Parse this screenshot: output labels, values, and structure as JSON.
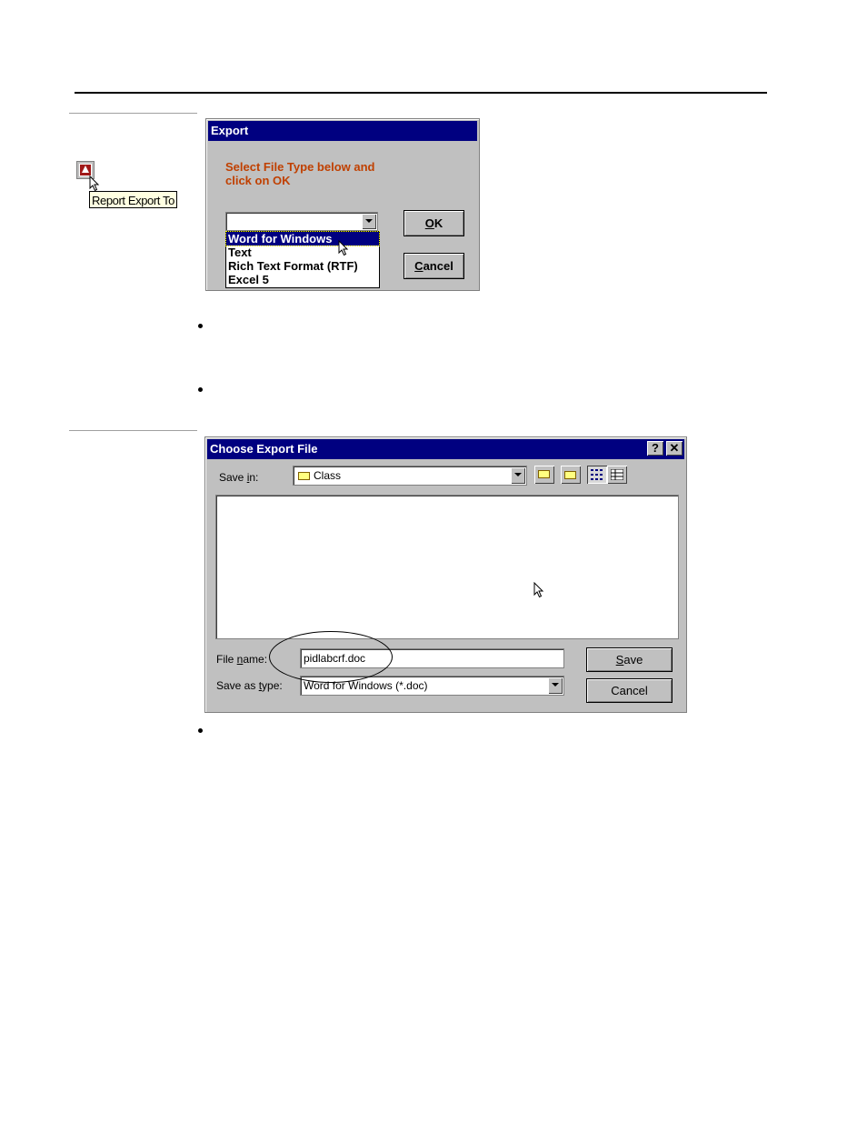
{
  "tooltip": {
    "text": "Report Export To"
  },
  "export_dialog": {
    "title": "Export",
    "prompt_line1": "Select File Type below and",
    "prompt_line2": "click on OK",
    "select_value": "",
    "options": [
      "Word for Windows",
      "Text",
      "Rich Text Format (RTF)",
      "Excel 5"
    ],
    "selected_index": 0,
    "ok_label": "OK",
    "ok_mnemonic": "O",
    "ok_rest": "K",
    "cancel_mnemonic": "C",
    "cancel_rest": "ancel"
  },
  "save_dialog": {
    "title": "Choose Export File",
    "help_glyph": "?",
    "close_glyph": "✕",
    "save_in_label_pre": "Save ",
    "save_in_label_mn": "i",
    "save_in_label_post": "n:",
    "save_in_value": "Class",
    "file_name_label_pre": "File ",
    "file_name_label_mn": "n",
    "file_name_label_post": "ame:",
    "file_name_value": "pidlabcrf.doc",
    "save_as_type_label_pre": "Save as ",
    "save_as_type_label_mn": "t",
    "save_as_type_label_post": "ype:",
    "save_as_type_value": "Word for Windows (*.doc)",
    "save_mn": "S",
    "save_rest": "ave",
    "cancel_label": "Cancel"
  },
  "colors": {
    "titlebar": "#000080",
    "prompt": "#c04000",
    "dialog_bg": "#c0c0c0"
  }
}
